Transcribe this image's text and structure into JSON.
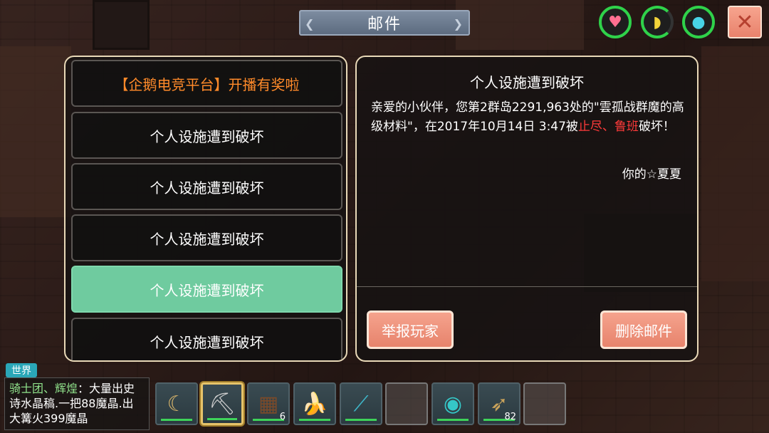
{
  "title": "邮件",
  "status": {
    "heart_icon": "heart-icon",
    "food_icon": "banana-icon",
    "water_icon": "water-drop-icon",
    "close_label": "✕"
  },
  "mail_list": [
    {
      "label": "【企鹅电竞平台】开播有奖啦"
    },
    {
      "label": "个人设施遭到破坏"
    },
    {
      "label": "个人设施遭到破坏"
    },
    {
      "label": "个人设施遭到破坏"
    },
    {
      "label": "个人设施遭到破坏"
    },
    {
      "label": "个人设施遭到破坏"
    }
  ],
  "selected_index": 4,
  "detail": {
    "title": "个人设施遭到破坏",
    "body_part1": "亲爱的小伙伴，您第2群岛2291,963处的\"雲孤战群魔的高级材料\"，在2017年10月14日 3:47被",
    "body_red": "止尽、鲁班",
    "body_part2": "破坏！",
    "signature": "你的☆夏夏",
    "report_label": "举报玩家",
    "delete_label": "删除邮件"
  },
  "chat": {
    "channel": "世界",
    "name": "骑士团、辉煌",
    "message": "：大量出史诗水晶稿.一把88魔晶.出大篝火399魔晶"
  },
  "hotbar": [
    {
      "icon": "scythe-icon",
      "glyph": "☾",
      "count": ""
    },
    {
      "icon": "pickaxe-icon",
      "glyph": "⛏",
      "count": "",
      "selected": true
    },
    {
      "icon": "dirt-block-icon",
      "glyph": "▦",
      "count": "6"
    },
    {
      "icon": "banana-icon",
      "glyph": "🍌",
      "count": ""
    },
    {
      "icon": "spear-icon",
      "glyph": "⟋",
      "count": ""
    },
    {
      "icon": "empty-slot",
      "glyph": "",
      "count": ""
    },
    {
      "icon": "orb-icon",
      "glyph": "◉",
      "count": ""
    },
    {
      "icon": "arrow-icon",
      "glyph": "➶",
      "count": "82"
    },
    {
      "icon": "empty-slot",
      "glyph": "",
      "count": ""
    }
  ]
}
